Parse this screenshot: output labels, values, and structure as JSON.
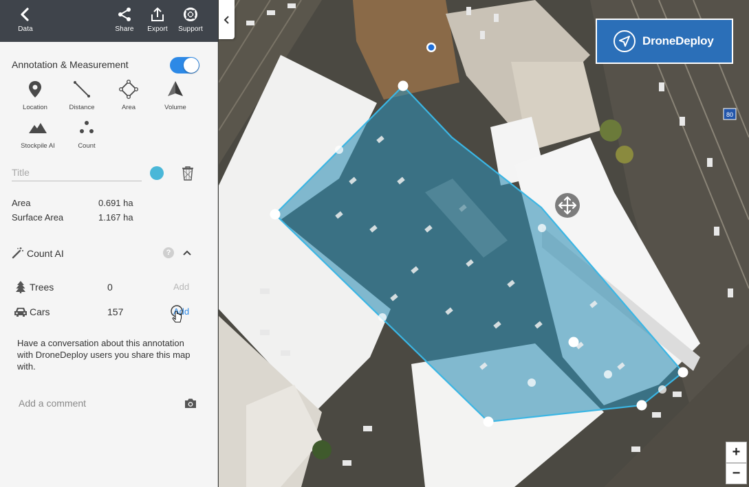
{
  "topbar": {
    "data_label": "Data",
    "share_label": "Share",
    "export_label": "Export",
    "support_label": "Support"
  },
  "annotation": {
    "section_title": "Annotation & Measurement",
    "toggle_on": true,
    "tools": [
      {
        "label": "Location",
        "icon": "pin-icon"
      },
      {
        "label": "Distance",
        "icon": "ruler-line-icon"
      },
      {
        "label": "Area",
        "icon": "polygon-icon"
      },
      {
        "label": "Volume",
        "icon": "pyramid-icon"
      },
      {
        "label": "Stockpile AI",
        "icon": "mountain-icon"
      },
      {
        "label": "Count",
        "icon": "three-dots-icon"
      }
    ],
    "title_placeholder": "Title",
    "title_value": "",
    "color": "#4ab7d8"
  },
  "metrics": [
    {
      "label": "Area",
      "value": "0.691 ha"
    },
    {
      "label": "Surface Area",
      "value": "1.167 ha"
    }
  ],
  "count_ai": {
    "title": "Count AI",
    "help_glyph": "?",
    "rows": [
      {
        "label": "Trees",
        "value": "0",
        "action": "Add",
        "icon": "tree-icon",
        "enabled": false
      },
      {
        "label": "Cars",
        "value": "157",
        "action": "Add",
        "icon": "car-icon",
        "enabled": true
      }
    ]
  },
  "conversation": {
    "text": "Have a conversation about this annotation with DroneDeploy users you share this map with.",
    "comment_placeholder": "Add a comment"
  },
  "map": {
    "logo_text": "DroneDeploy",
    "road_sign": "80",
    "zoom_in": "+",
    "zoom_out": "−",
    "polygon_color": "#38a9d6"
  }
}
